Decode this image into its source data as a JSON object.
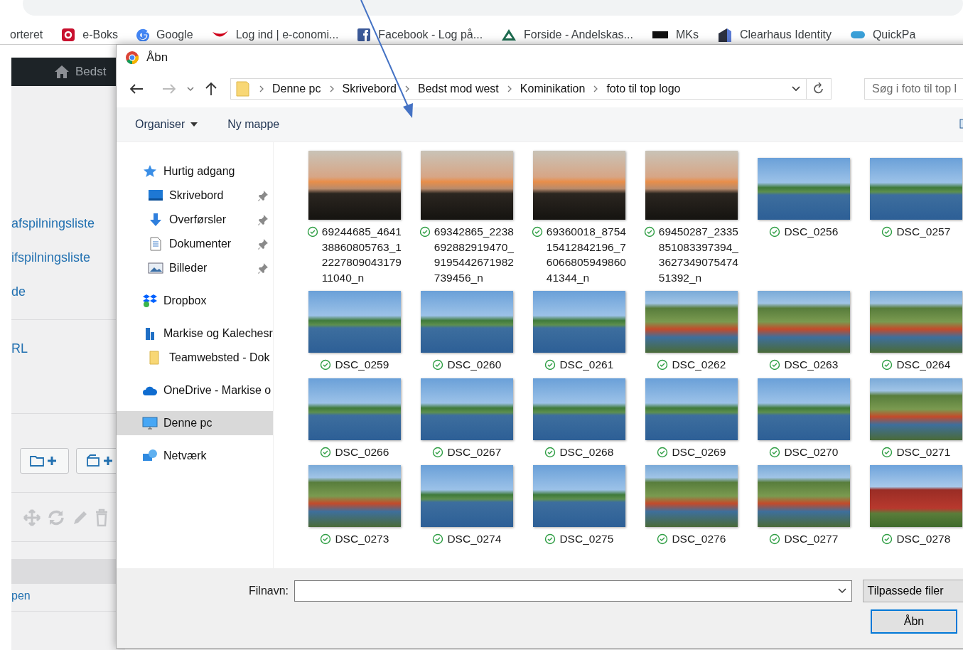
{
  "bookmarks": [
    {
      "label": "orteret",
      "kind": "none"
    },
    {
      "label": "e-Boks",
      "kind": "red-square"
    },
    {
      "label": "Google",
      "kind": "g"
    },
    {
      "label": "Log ind | e-conomi...",
      "kind": "red-swoosh"
    },
    {
      "label": "Facebook - Log på...",
      "kind": "blue-square"
    },
    {
      "label": "Forside - Andelskas...",
      "kind": "triangle"
    },
    {
      "label": "MKs",
      "kind": "mks"
    },
    {
      "label": "Clearhaus Identity",
      "kind": "block"
    },
    {
      "label": "QuickPa",
      "kind": "pill"
    }
  ],
  "admin_bar": {
    "label": "Bedst"
  },
  "background_sidebar": {
    "links": [
      "afspilningsliste",
      "ifspilningsliste",
      "de"
    ],
    "url_label": "RL",
    "footer_link": "pen"
  },
  "dialog": {
    "title": "Åbn",
    "path": [
      "Denne pc",
      "Skrivebord",
      "Bedst mod west",
      "Kominikation",
      "foto til top logo"
    ],
    "search_placeholder": "Søg i foto til top l",
    "toolbar": {
      "organise": "Organiser",
      "new_folder": "Ny mappe"
    },
    "nav_pane": [
      {
        "label": "Hurtig adgang",
        "kind": "star",
        "selected": false,
        "children": [
          {
            "label": "Skrivebord",
            "kind": "desktop",
            "selected": false,
            "pinned": true
          },
          {
            "label": "Overførsler",
            "kind": "download",
            "selected": false,
            "pinned": true
          },
          {
            "label": "Dokumenter",
            "kind": "document",
            "selected": false,
            "pinned": true
          },
          {
            "label": "Billeder",
            "kind": "pictures",
            "selected": false,
            "pinned": true
          }
        ]
      },
      {
        "label": "Dropbox",
        "kind": "dropbox",
        "selected": false
      },
      {
        "label": "Markise og Kalechesr",
        "kind": "building",
        "selected": false,
        "children": [
          {
            "label": "Teamwebsted - Dok",
            "kind": "folder",
            "selected": false,
            "pinned": false
          }
        ]
      },
      {
        "label": "OneDrive - Markise o",
        "kind": "cloud",
        "selected": false
      },
      {
        "label": "Denne pc",
        "kind": "computer",
        "selected": true
      },
      {
        "label": "Netværk",
        "kind": "network",
        "selected": false
      }
    ],
    "files": [
      {
        "name": "69244685_464138860805763_1222780904317911040_n",
        "kind": "sunset"
      },
      {
        "name": "69342865_2238692882919470_9195442671982739456_n",
        "kind": "sunset"
      },
      {
        "name": "69360018_875415412842196_7606680594986041344_n",
        "kind": "sunset"
      },
      {
        "name": "69450287_2335851083397394_362734907547451392_n",
        "kind": "sunset"
      },
      {
        "name": "DSC_0256",
        "kind": "harbor"
      },
      {
        "name": "DSC_0257",
        "kind": "harbor"
      },
      {
        "name": "DSC_0259",
        "kind": "harbor"
      },
      {
        "name": "DSC_0260",
        "kind": "harbor"
      },
      {
        "name": "DSC_0261",
        "kind": "harbor"
      },
      {
        "name": "DSC_0262",
        "kind": "boats"
      },
      {
        "name": "DSC_0263",
        "kind": "boats"
      },
      {
        "name": "DSC_0264",
        "kind": "boats"
      },
      {
        "name": "DSC_0266",
        "kind": "harbor"
      },
      {
        "name": "DSC_0267",
        "kind": "harbor"
      },
      {
        "name": "DSC_0268",
        "kind": "harbor"
      },
      {
        "name": "DSC_0269",
        "kind": "harbor"
      },
      {
        "name": "DSC_0270",
        "kind": "harbor"
      },
      {
        "name": "DSC_0271",
        "kind": "boats"
      },
      {
        "name": "DSC_0273",
        "kind": "boats"
      },
      {
        "name": "DSC_0274",
        "kind": "harbor"
      },
      {
        "name": "DSC_0275",
        "kind": "harbor"
      },
      {
        "name": "DSC_0276",
        "kind": "boats"
      },
      {
        "name": "DSC_0277",
        "kind": "boats"
      },
      {
        "name": "DSC_0278",
        "kind": "house"
      }
    ],
    "filename_label": "Filnavn:",
    "filter": "Tilpassede filer",
    "open_button": "Åbn"
  }
}
